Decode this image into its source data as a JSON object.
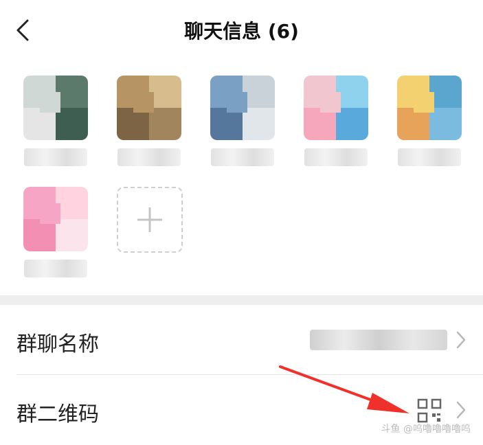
{
  "header": {
    "title": "聊天信息 (6)"
  },
  "members": [
    {
      "colors": [
        "#cfd8d4",
        "#5c7a6c",
        "#e5e5e5",
        "#3e5e52"
      ]
    },
    {
      "colors": [
        "#b69464",
        "#d7bc8e",
        "#7d6444",
        "#a1855c"
      ]
    },
    {
      "colors": [
        "#7aa0c4",
        "#c8d2d8",
        "#55779b",
        "#e1e6ea"
      ]
    },
    {
      "colors": [
        "#f2c6ce",
        "#8fd2ee",
        "#f7a7bb",
        "#5aa9dd"
      ],
      "name_dots": "…"
    },
    {
      "colors": [
        "#f3d170",
        "#5aa6ce",
        "#e8a35b",
        "#7bbbe0"
      ],
      "name_dots": "…"
    },
    {
      "colors": [
        "#f6a6c4",
        "#ffd3e0",
        "#f28fb3",
        "#fce4ec"
      ]
    }
  ],
  "settings": {
    "group_name_label": "群聊名称",
    "group_qr_label": "群二维码"
  },
  "colors": {
    "accent_arrow": "#f0302a",
    "divider": "#e6e6e6"
  },
  "watermark": "斗鱼 @呜嚕嚕嚕嚕呜"
}
